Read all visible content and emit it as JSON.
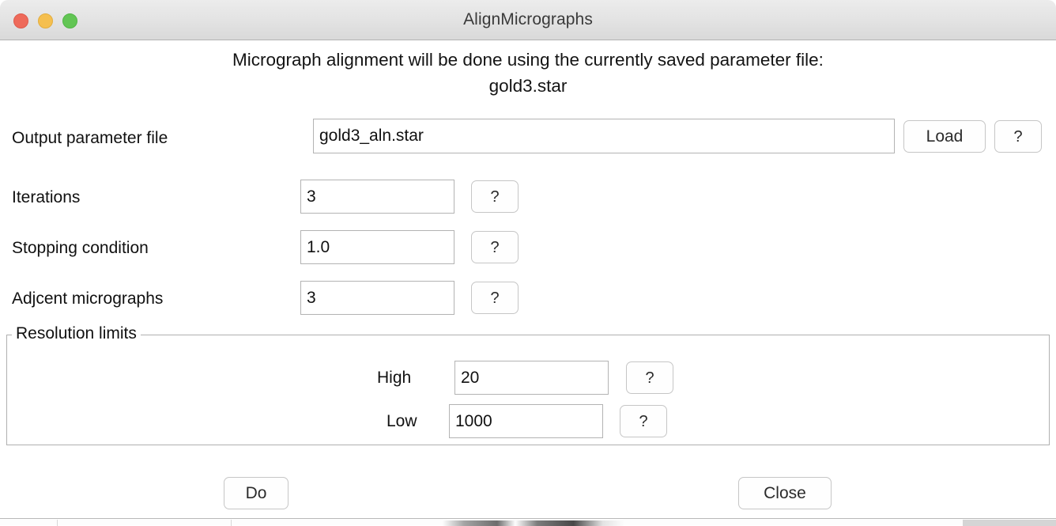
{
  "window": {
    "title": "AlignMicrographs",
    "traffic_lights": [
      {
        "name": "close",
        "color": "#ee6a5a"
      },
      {
        "name": "minimize",
        "color": "#f5bf4f"
      },
      {
        "name": "zoom",
        "color": "#62c554"
      }
    ]
  },
  "headline": {
    "line1": "Micrograph alignment will be done using the currently saved parameter file:",
    "line2": "gold3.star"
  },
  "form": {
    "output_file": {
      "label": "Output parameter file",
      "value": "gold3_aln.star",
      "load_label": "Load",
      "help_label": "?"
    },
    "iterations": {
      "label": "Iterations",
      "value": "3",
      "help_label": "?"
    },
    "stopping_condition": {
      "label": "Stopping condition",
      "value": "1.0",
      "help_label": "?"
    },
    "adjacent_micrographs": {
      "label": "Adjcent micrographs",
      "value": "3",
      "help_label": "?"
    }
  },
  "resolution_limits": {
    "legend": "Resolution limits",
    "high": {
      "label": "High",
      "value": "20",
      "help_label": "?"
    },
    "low": {
      "label": "Low",
      "value": "1000",
      "help_label": "?"
    }
  },
  "actions": {
    "do_label": "Do",
    "close_label": "Close"
  }
}
